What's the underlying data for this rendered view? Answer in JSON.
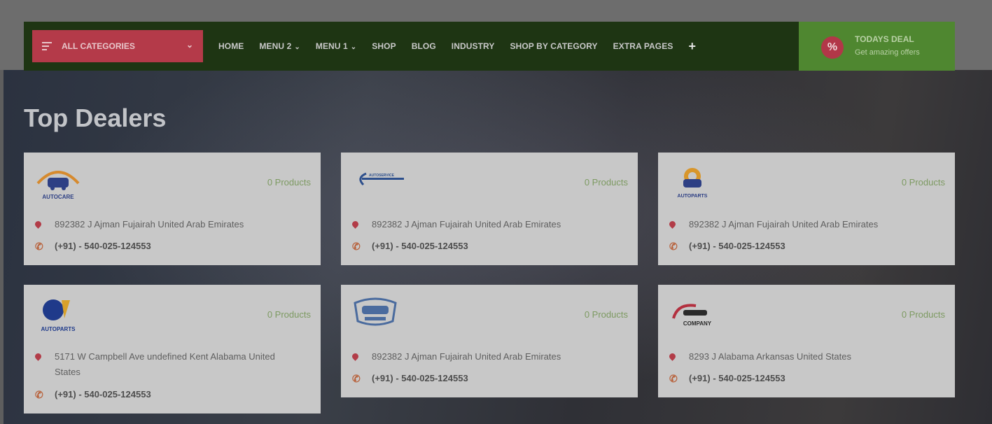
{
  "nav": {
    "categories_label": "ALL CATEGORIES",
    "items": [
      "HOME",
      "MENU 2",
      "MENU 1",
      "SHOP",
      "BLOG",
      "INDUSTRY",
      "SHOP BY CATEGORY",
      "EXTRA PAGES"
    ],
    "plus": "+",
    "deal_title": "TODAYS DEAL",
    "deal_subtitle": "Get amazing offers"
  },
  "section": {
    "title": "Top Dealers"
  },
  "dealers": [
    {
      "logo": "AUTOCARE",
      "products": "0 Products",
      "address": "892382 J Ajman Fujairah United Arab Emirates",
      "phone": "(+91) - 540-025-124553"
    },
    {
      "logo": "AUTOSERVICE",
      "products": "0 Products",
      "address": "892382 J Ajman Fujairah United Arab Emirates",
      "phone": "(+91) - 540-025-124553"
    },
    {
      "logo": "AUTOPARTS",
      "products": "0 Products",
      "address": "892382 J Ajman Fujairah United Arab Emirates",
      "phone": "(+91) - 540-025-124553"
    },
    {
      "logo": "AUTOPARTS",
      "products": "0 Products",
      "address": "5171 W Campbell Ave undefined Kent Alabama United States",
      "phone": "(+91) - 540-025-124553"
    },
    {
      "logo": "",
      "products": "0 Products",
      "address": "892382 J Ajman Fujairah United Arab Emirates",
      "phone": "(+91) - 540-025-124553"
    },
    {
      "logo": "COMPANY",
      "products": "0 Products",
      "address": "8293 J Alabama Arkansas United States",
      "phone": "(+91) - 540-025-124553"
    }
  ],
  "colors": {
    "nav_bg": "#1e3513",
    "category_button": "#b43a49",
    "deal_bg": "#4f8730",
    "products_text": "#7d9a62"
  }
}
